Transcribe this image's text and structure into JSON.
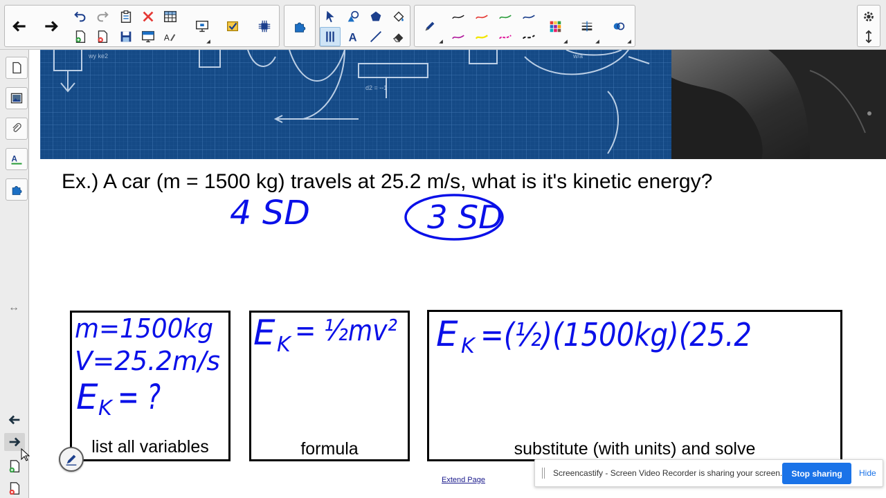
{
  "canvas": {
    "question": "Ex.) A car (m = 1500 kg) travels at 25.2 m/s, what is it's kinetic energy?",
    "panels": [
      {
        "label": "list all variables"
      },
      {
        "label": "formula"
      },
      {
        "label": "substitute (with units) and solve"
      }
    ],
    "extend_link": "Extend Page"
  },
  "handwriting": {
    "sig_fig_1": "4 SD",
    "sig_fig_2": "3 SD",
    "variables": [
      "m=1500kg",
      "V=25.2m/s",
      "E",
      "K",
      "= ?"
    ],
    "formula_lhs": "E",
    "formula_sub": "K",
    "formula_rhs": "= ½mv²",
    "substitution": "=(½)(1500kg)(25.2"
  },
  "notification": {
    "message": "Screencastify - Screen Video Recorder is sharing your screen.",
    "stop_label": "Stop sharing",
    "hide_label": "Hide"
  },
  "colors": {
    "ink": "#0a10e8",
    "accent": "#1a73e8"
  }
}
